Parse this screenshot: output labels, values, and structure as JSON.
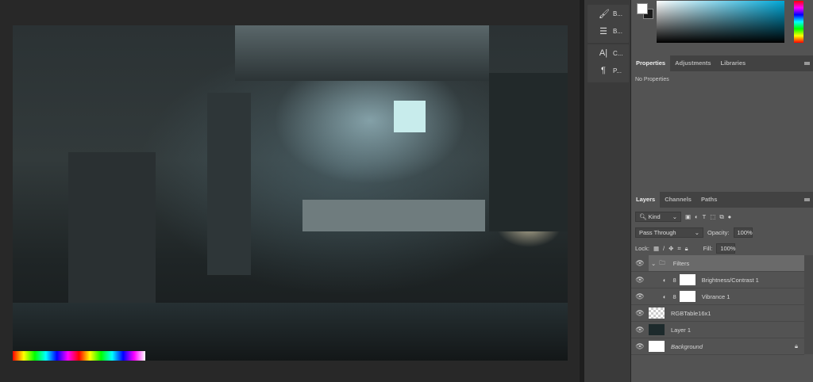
{
  "tools": [
    {
      "icon": "brush-presets-icon",
      "label": "B..."
    },
    {
      "icon": "brush-settings-icon",
      "label": "B..."
    },
    {
      "icon": "character-icon",
      "label": "C..."
    },
    {
      "icon": "paragraph-icon",
      "label": "P..."
    }
  ],
  "properties": {
    "tabs": [
      "Properties",
      "Adjustments",
      "Libraries"
    ],
    "content": "No Properties"
  },
  "layers_panel": {
    "tabs": [
      "Layers",
      "Channels",
      "Paths"
    ],
    "filter_kind": "Kind",
    "blend_mode": "Pass Through",
    "opacity_label": "Opacity:",
    "opacity": "100%",
    "lock_label": "Lock:",
    "fill_label": "Fill:",
    "fill": "100%"
  },
  "layers": [
    {
      "name": "Filters",
      "type": "group"
    },
    {
      "name": "Brightness/Contrast 1",
      "type": "adjustment"
    },
    {
      "name": "Vibrance 1",
      "type": "adjustment"
    },
    {
      "name": "RGBTable16x1",
      "type": "smart"
    },
    {
      "name": "Layer 1",
      "type": "pixel"
    },
    {
      "name": "Background",
      "type": "background",
      "locked": true
    }
  ],
  "colors": {
    "foreground": "#ffffff",
    "background": "#1b1b1b",
    "picker_hue": "#00a8d8"
  }
}
